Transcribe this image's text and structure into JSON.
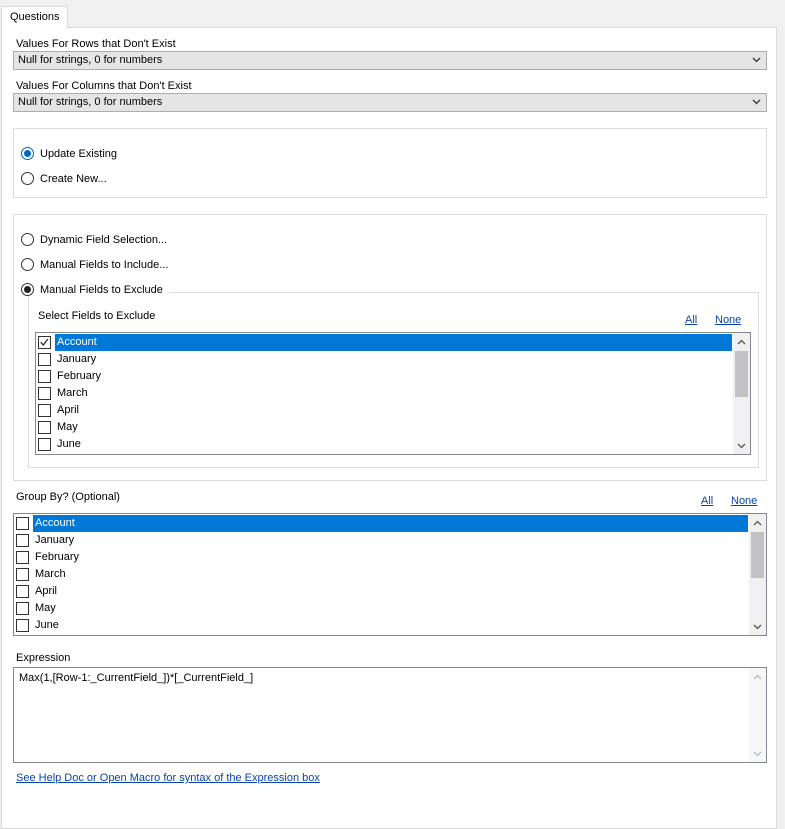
{
  "tab": {
    "label": "Questions"
  },
  "rows_missing": {
    "label": "Values For Rows that Don't Exist",
    "value": "Null for strings, 0 for numbers"
  },
  "cols_missing": {
    "label": "Values For Columns that Don't Exist",
    "value": "Null for strings, 0 for numbers"
  },
  "mode": {
    "options": [
      "Update Existing",
      "Create New..."
    ],
    "selected": "Update Existing"
  },
  "field_selection": {
    "options": [
      "Dynamic Field Selection...",
      "Manual Fields to Include...",
      "Manual Fields to Exclude"
    ],
    "selected": "Manual Fields to Exclude",
    "list_label": "Select Fields to Exclude",
    "all_label": "All",
    "none_label": "None",
    "fields": [
      {
        "name": "Account",
        "checked": true,
        "selected": true
      },
      {
        "name": "January",
        "checked": false,
        "selected": false
      },
      {
        "name": "February",
        "checked": false,
        "selected": false
      },
      {
        "name": "March",
        "checked": false,
        "selected": false
      },
      {
        "name": "April",
        "checked": false,
        "selected": false
      },
      {
        "name": "May",
        "checked": false,
        "selected": false
      },
      {
        "name": "June",
        "checked": false,
        "selected": false
      }
    ]
  },
  "group_by": {
    "label": "Group By? (Optional)",
    "all_label": "All",
    "none_label": "None",
    "fields": [
      {
        "name": "Account",
        "checked": false,
        "selected": true
      },
      {
        "name": "January",
        "checked": false,
        "selected": false
      },
      {
        "name": "February",
        "checked": false,
        "selected": false
      },
      {
        "name": "March",
        "checked": false,
        "selected": false
      },
      {
        "name": "April",
        "checked": false,
        "selected": false
      },
      {
        "name": "May",
        "checked": false,
        "selected": false
      },
      {
        "name": "June",
        "checked": false,
        "selected": false
      }
    ]
  },
  "expression": {
    "label": "Expression",
    "value": "Max(1,[Row-1:_CurrentField_])*[_CurrentField_]"
  },
  "help_link": {
    "label": "See Help Doc or Open Macro for syntax of the Expression box"
  },
  "colors": {
    "accent": "#0078d7",
    "link": "#0645ad",
    "radio_selected": "#0067c0"
  }
}
